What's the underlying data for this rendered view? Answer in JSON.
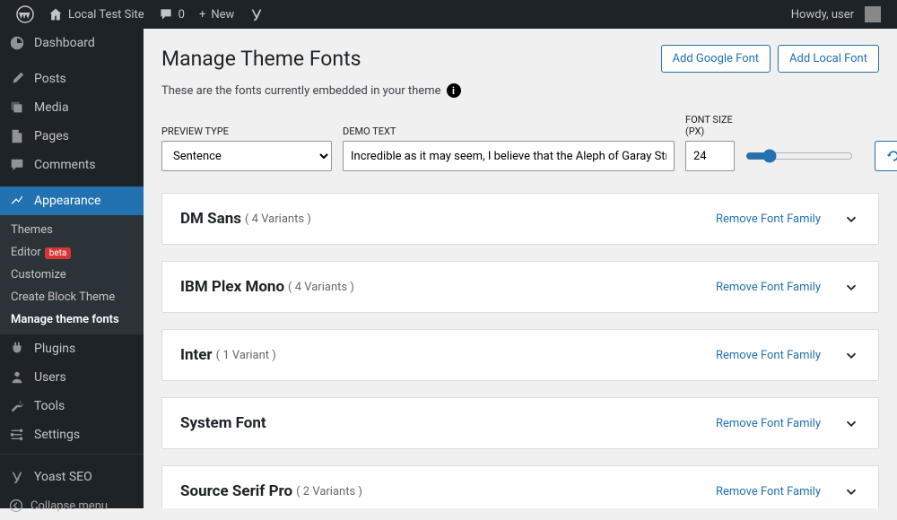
{
  "toolbar": {
    "site_name": "Local Test Site",
    "comments_count": "0",
    "new_label": "New",
    "greeting": "Howdy, user"
  },
  "sidebar": {
    "items": [
      {
        "label": "Dashboard"
      },
      {
        "label": "Posts"
      },
      {
        "label": "Media"
      },
      {
        "label": "Pages"
      },
      {
        "label": "Comments"
      },
      {
        "label": "Appearance"
      },
      {
        "label": "Plugins"
      },
      {
        "label": "Users"
      },
      {
        "label": "Tools"
      },
      {
        "label": "Settings"
      },
      {
        "label": "Yoast SEO"
      }
    ],
    "submenu": [
      {
        "label": "Themes"
      },
      {
        "label": "Editor",
        "beta": "beta"
      },
      {
        "label": "Customize"
      },
      {
        "label": "Create Block Theme"
      },
      {
        "label": "Manage theme fonts"
      }
    ],
    "collapse": "Collapse menu"
  },
  "page": {
    "title": "Manage Theme Fonts",
    "add_google": "Add Google Font",
    "add_local": "Add Local Font",
    "subtitle": "These are the fonts currently embedded in your theme"
  },
  "controls": {
    "preview_label": "PREVIEW TYPE",
    "preview_value": "Sentence",
    "demo_label": "DEMO TEXT",
    "demo_value": "Incredible as it may seem, I believe that the Aleph of Garay Street was a false Aleph.",
    "size_label": "FONT SIZE (PX)",
    "size_value": "24",
    "reset": "Reset"
  },
  "fonts": [
    {
      "name": "DM Sans",
      "variants": "( 4 Variants )",
      "remove": "Remove Font Family"
    },
    {
      "name": "IBM Plex Mono",
      "variants": "( 4 Variants )",
      "remove": "Remove Font Family"
    },
    {
      "name": "Inter",
      "variants": "( 1 Variant )",
      "remove": "Remove Font Family"
    },
    {
      "name": "System Font",
      "variants": "",
      "remove": "Remove Font Family"
    },
    {
      "name": "Source Serif Pro",
      "variants": "( 2 Variants )",
      "remove": "Remove Font Family"
    }
  ]
}
